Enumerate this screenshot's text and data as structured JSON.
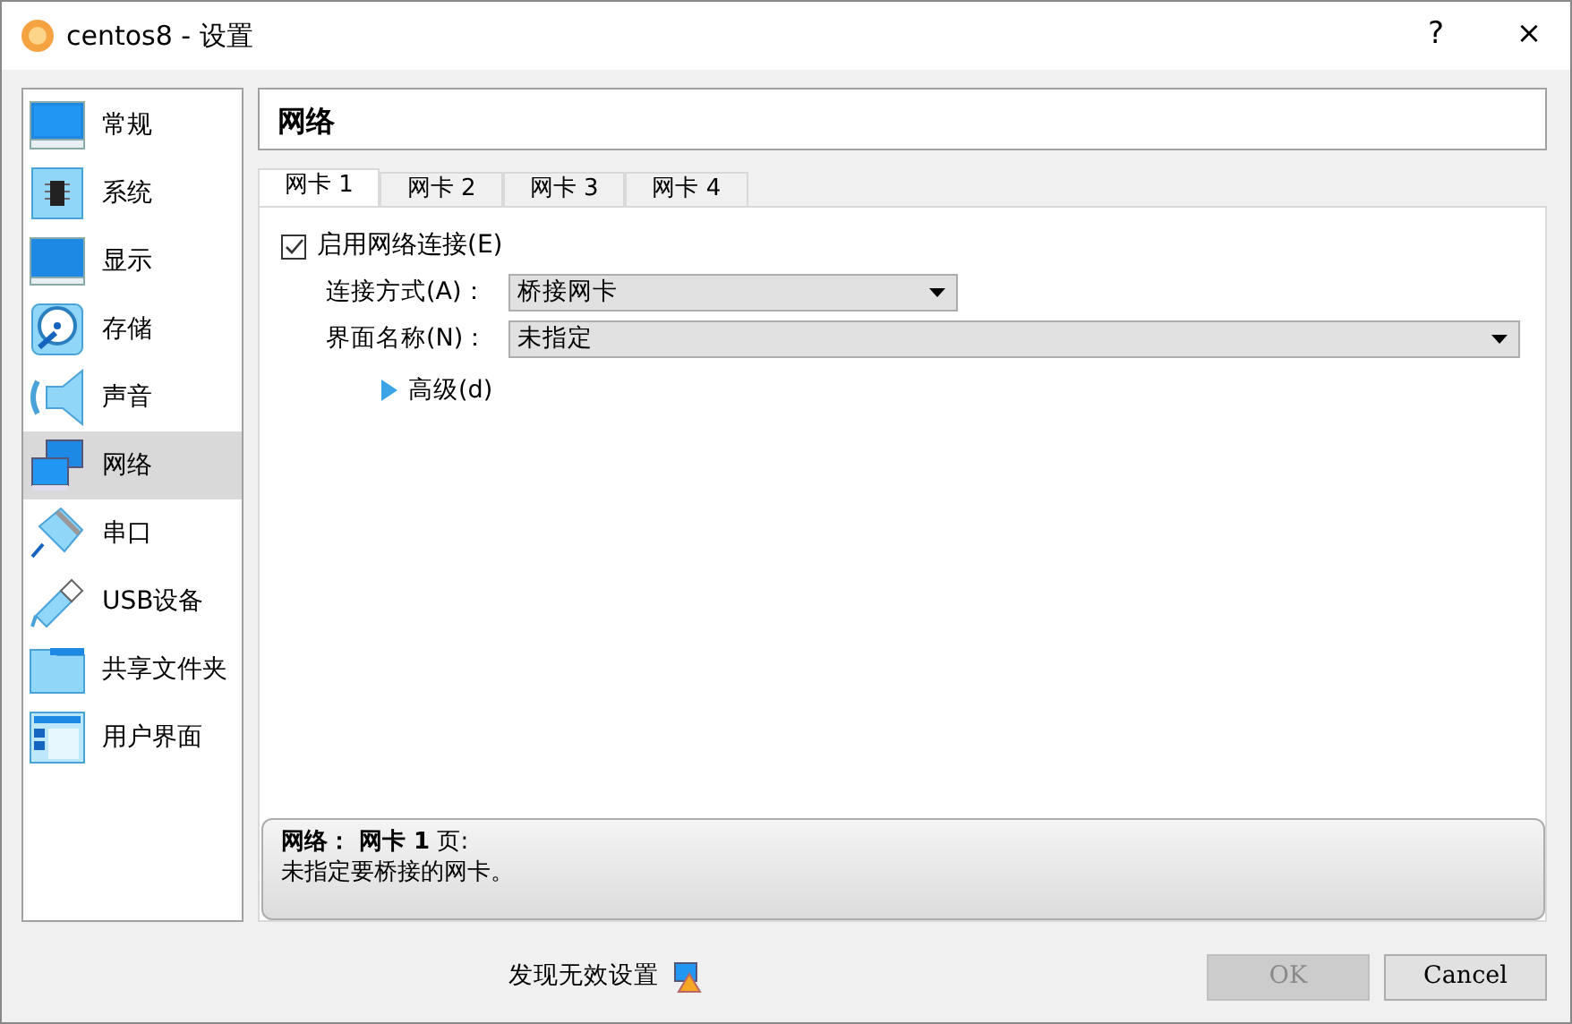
{
  "window": {
    "title": "centos8 - 设置",
    "buttons": [
      "?",
      "×"
    ]
  },
  "sidebar": {
    "items": [
      {
        "label": "常规",
        "selected": false
      },
      {
        "label": "系统",
        "selected": false
      },
      {
        "label": "显示",
        "selected": false
      },
      {
        "label": "存储",
        "selected": false
      },
      {
        "label": "声音",
        "selected": false
      },
      {
        "label": "网络",
        "selected": true
      },
      {
        "label": "串口",
        "selected": false
      },
      {
        "label": "USB设备",
        "selected": false
      },
      {
        "label": "共享文件夹",
        "selected": false
      },
      {
        "label": "用户界面",
        "selected": false
      }
    ]
  },
  "page_title": "网络",
  "tabs": [
    {
      "label": "网卡 1",
      "selected": true
    },
    {
      "label": "网卡 2",
      "selected": false
    },
    {
      "label": "网卡 3",
      "selected": false
    },
    {
      "label": "网卡 4",
      "selected": false
    }
  ],
  "enable": {
    "label": "启用网络连接(E)",
    "checked": true
  },
  "fields": [
    {
      "label": "连接方式(A)：",
      "value": "桥接网卡"
    },
    {
      "label": "界面名称(N)：",
      "value": "未指定"
    }
  ],
  "advanced": {
    "label": "高级(d)",
    "expanded": false
  },
  "info": {
    "heading": "**网络： 网卡 1** 页:",
    "message": "未指定要桥接的网卡。"
  },
  "footer": {
    "warning": "发现无效设置",
    "buttons": [
      {
        "label": "OK",
        "disabled": true
      },
      {
        "label": "Cancel",
        "disabled": false
      }
    ]
  }
}
